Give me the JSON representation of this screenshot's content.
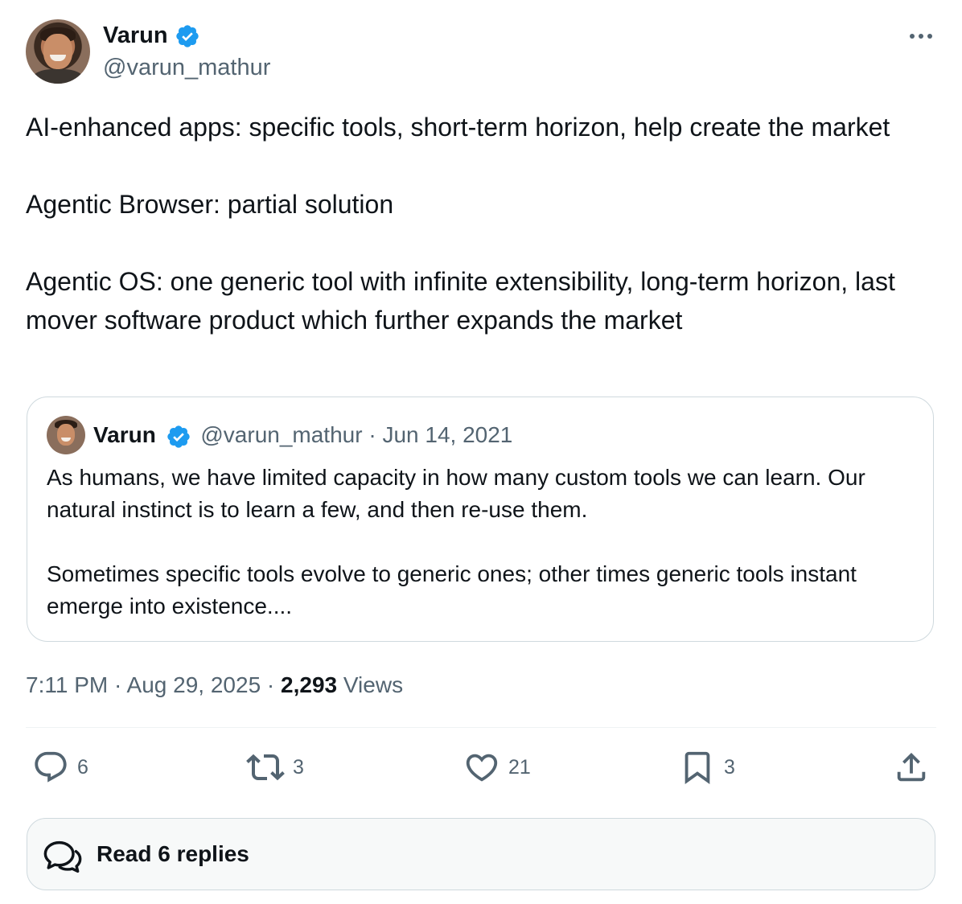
{
  "author": {
    "name": "Varun",
    "handle": "@varun_mathur",
    "verified": true,
    "avatar_icon": "profile-photo"
  },
  "tweet": {
    "text": "AI-enhanced apps: specific tools, short-term horizon, help create the market\n\nAgentic Browser: partial solution\n\nAgentic OS: one generic tool with infinite extensibility, long-term horizon, last mover software product which further expands the market"
  },
  "quote": {
    "name": "Varun",
    "handle": "@varun_mathur",
    "separator": "·",
    "date": "Jun 14, 2021",
    "text": "As humans, we have limited capacity in how many custom tools we can learn. Our natural instinct is to learn a few, and then re-use them.\n\nSometimes specific tools evolve to generic ones; other times generic tools instant emerge into existence...."
  },
  "meta": {
    "time": "7:11 PM",
    "sep1": "·",
    "date": "Aug 29, 2025",
    "sep2": "·",
    "views_count": "2,293",
    "views_label": "Views"
  },
  "actions": {
    "replies": "6",
    "reposts": "3",
    "likes": "21",
    "bookmarks": "3"
  },
  "read_replies": {
    "label": "Read 6 replies"
  },
  "colors": {
    "text_primary": "#0f1419",
    "text_secondary": "#536471",
    "verified_blue": "#1d9bf0",
    "border": "#cfd9de"
  }
}
